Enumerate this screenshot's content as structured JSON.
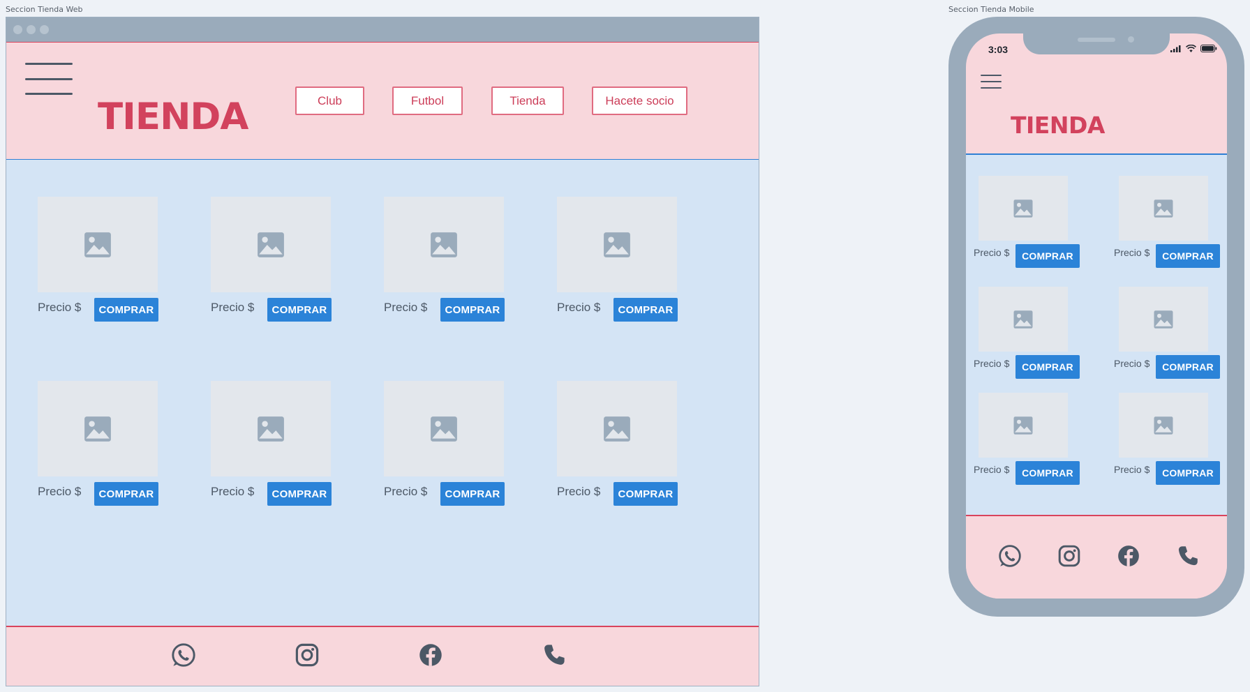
{
  "web": {
    "frame_label": "Seccion Tienda Web",
    "title": "TIENDA",
    "nav": [
      "Club",
      "Futbol",
      "Tienda",
      "Hacete socio"
    ],
    "products": [
      {
        "price": "Precio $",
        "button": "COMPRAR"
      },
      {
        "price": "Precio $",
        "button": "COMPRAR"
      },
      {
        "price": "Precio $",
        "button": "COMPRAR"
      },
      {
        "price": "Precio $",
        "button": "COMPRAR"
      },
      {
        "price": "Precio $",
        "button": "COMPRAR"
      },
      {
        "price": "Precio $",
        "button": "COMPRAR"
      },
      {
        "price": "Precio $",
        "button": "COMPRAR"
      },
      {
        "price": "Precio $",
        "button": "COMPRAR"
      }
    ],
    "footer_icons": [
      "whatsapp-icon",
      "instagram-icon",
      "facebook-icon",
      "phone-icon"
    ]
  },
  "mobile": {
    "frame_label": "Seccion Tienda Mobile",
    "status_time": "3:03",
    "title": "TIENDA",
    "products": [
      {
        "price": "Precio $",
        "button": "COMPRAR"
      },
      {
        "price": "Precio $",
        "button": "COMPRAR"
      },
      {
        "price": "Precio $",
        "button": "COMPRAR"
      },
      {
        "price": "Precio $",
        "button": "COMPRAR"
      },
      {
        "price": "Precio $",
        "button": "COMPRAR"
      },
      {
        "price": "Precio $",
        "button": "COMPRAR"
      }
    ],
    "footer_icons": [
      "whatsapp-icon",
      "instagram-icon",
      "facebook-icon",
      "phone-icon"
    ]
  },
  "colors": {
    "accent_red": "#d2425d",
    "buy_blue": "#2b83d8",
    "header_pink": "#f8d7dc",
    "content_blue": "#d4e4f5"
  }
}
